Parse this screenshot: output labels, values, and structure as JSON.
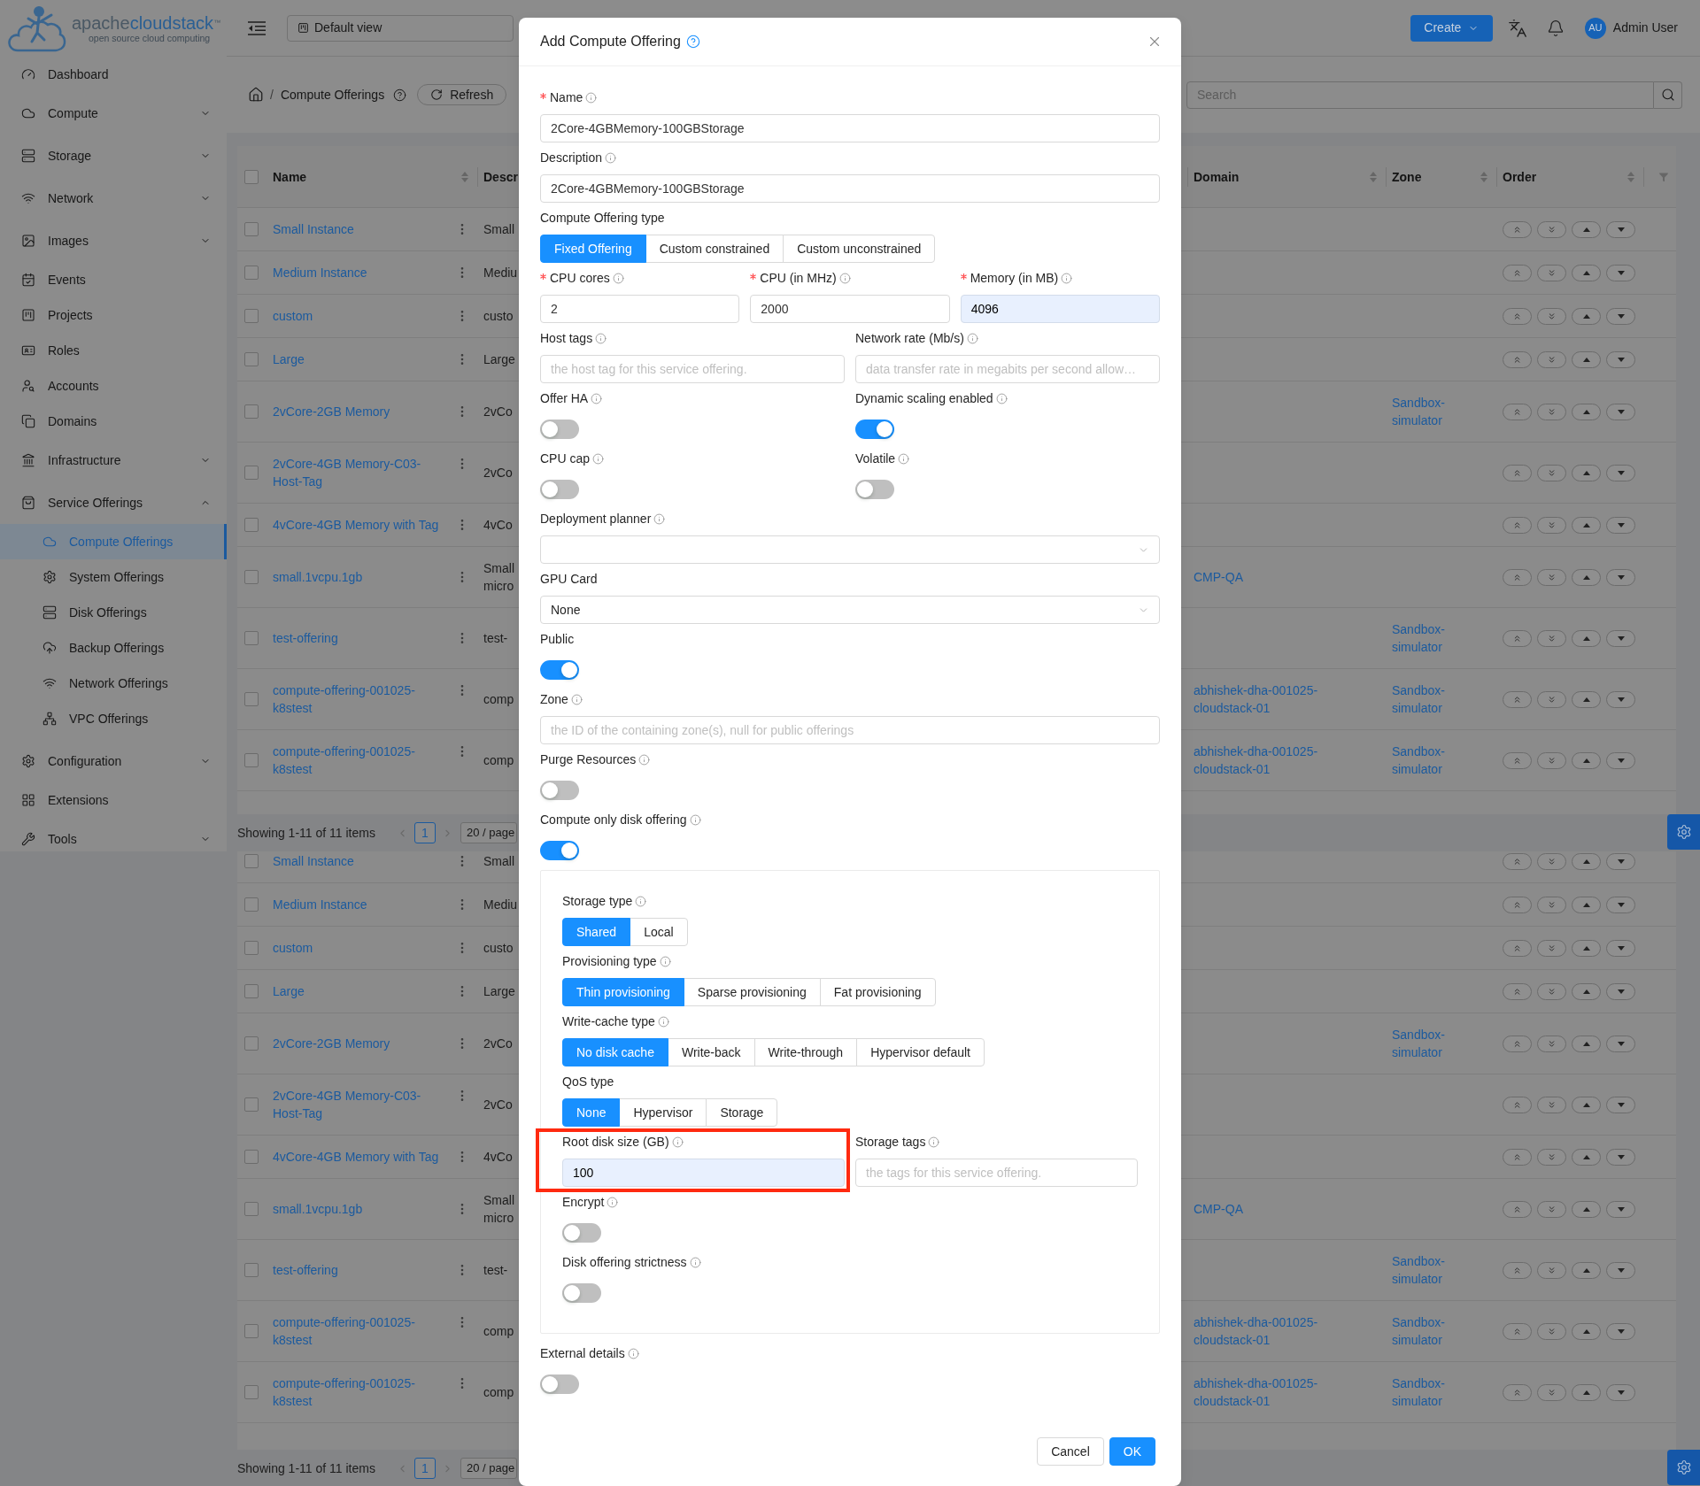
{
  "sidebar": {
    "logo": {
      "wordmark_prefix": "apache",
      "wordmark": "cloudstack",
      "trademark": "™",
      "tagline": "open source cloud computing"
    },
    "items": [
      {
        "label": "Dashboard",
        "kind": "item",
        "selected": false
      },
      {
        "label": "Compute",
        "kind": "submenu",
        "expanded": false,
        "selected": false
      },
      {
        "label": "Storage",
        "kind": "submenu",
        "expanded": false,
        "selected": false
      },
      {
        "label": "Network",
        "kind": "submenu",
        "expanded": false,
        "selected": false
      },
      {
        "label": "Images",
        "kind": "submenu",
        "expanded": false,
        "selected": false
      },
      {
        "label": "Events",
        "kind": "item",
        "selected": false
      },
      {
        "label": "Projects",
        "kind": "item",
        "selected": false
      },
      {
        "label": "Roles",
        "kind": "item",
        "selected": false
      },
      {
        "label": "Accounts",
        "kind": "item",
        "selected": false
      },
      {
        "label": "Domains",
        "kind": "item",
        "selected": false
      },
      {
        "label": "Infrastructure",
        "kind": "submenu",
        "expanded": false,
        "selected": false
      },
      {
        "label": "Service Offerings",
        "kind": "submenu",
        "expanded": true,
        "selected": false,
        "children": [
          {
            "label": "Compute Offerings",
            "selected": true
          },
          {
            "label": "System Offerings",
            "selected": false
          },
          {
            "label": "Disk Offerings",
            "selected": false
          },
          {
            "label": "Backup Offerings",
            "selected": false
          },
          {
            "label": "Network Offerings",
            "selected": false
          },
          {
            "label": "VPC Offerings",
            "selected": false
          }
        ]
      },
      {
        "label": "Configuration",
        "kind": "submenu",
        "expanded": false,
        "selected": false
      },
      {
        "label": "Extensions",
        "kind": "item",
        "selected": false
      },
      {
        "label": "Tools",
        "kind": "submenu",
        "expanded": false,
        "selected": false
      }
    ]
  },
  "header": {
    "view_select": "Default view",
    "create_button": "Create",
    "user_initials": "AU",
    "user_name": "Admin User"
  },
  "page_header": {
    "breadcrumb": {
      "separator": "/",
      "current": "Compute Offerings"
    },
    "refresh_button": "Refresh",
    "search": {
      "placeholder": "Search"
    }
  },
  "table": {
    "select_all": false,
    "columns": [
      {
        "label": "Name",
        "sortable": true
      },
      {
        "label": "Descr"
      },
      {
        "label": "Domain",
        "sortable": true
      },
      {
        "label": "Zone",
        "sortable": true
      },
      {
        "label": "Order",
        "sortable": true
      }
    ],
    "rows": [
      {
        "name": "Small Instance",
        "description": "Small",
        "checked": false
      },
      {
        "name": "Medium Instance",
        "description": "Mediu",
        "checked": false
      },
      {
        "name": "custom",
        "description": "custo",
        "checked": false
      },
      {
        "name": "Large",
        "description": "Large",
        "checked": false
      },
      {
        "name": "2vCore-2GB Memory",
        "description": "2vCo",
        "zone": "Sandbox-simulator",
        "checked": false
      },
      {
        "name": "2vCore-4GB Memory-C03-Host-Tag",
        "description": "2vCo",
        "checked": false
      },
      {
        "name": "4vCore-4GB Memory with Tag",
        "description": "4vCo",
        "checked": false
      },
      {
        "name": "small.1vcpu.1gb",
        "description": "Small micro",
        "domain": "CMP-QA",
        "checked": false
      },
      {
        "name": "test-offering",
        "description": "test-",
        "zone": "Sandbox-simulator",
        "checked": false
      },
      {
        "name": "compute-offering-001025-k8stest",
        "description": "comp",
        "domain": "abhishek-dha-001025-cloudstack-01",
        "zone": "Sandbox-simulator",
        "checked": false
      },
      {
        "name": "compute-offering-001025-k8stest",
        "description": "comp",
        "domain": "abhishek-dha-001025-cloudstack-01",
        "zone": "Sandbox-simulator",
        "checked": false
      }
    ],
    "pagination": {
      "summary": "Showing 1-11 of 11 items",
      "pages": [
        {
          "label": "1",
          "selected": true
        }
      ],
      "page_size": "20 / page"
    }
  },
  "table_repeated": {
    "rows": [
      {
        "name": "Small Instance",
        "description": "Small",
        "checked": false
      },
      {
        "name": "Medium Instance",
        "description": "Mediu",
        "checked": false
      },
      {
        "name": "custom",
        "description": "custo",
        "checked": false
      },
      {
        "name": "Large",
        "description": "Large",
        "checked": false
      },
      {
        "name": "2vCore-2GB Memory",
        "description": "2vCo",
        "zone": "Sandbox-simulator",
        "checked": false
      },
      {
        "name": "2vCore-4GB Memory-C03-Host-Tag",
        "description": "2vCo",
        "checked": false
      },
      {
        "name": "4vCore-4GB Memory with Tag",
        "description": "4vCo",
        "checked": false
      },
      {
        "name": "small.1vcpu.1gb",
        "description": "Small micro",
        "domain": "CMP-QA",
        "checked": false
      },
      {
        "name": "test-offering",
        "description": "test-",
        "zone": "Sandbox-simulator",
        "checked": false
      },
      {
        "name": "compute-offering-001025-k8stest",
        "description": "comp",
        "domain": "abhishek-dha-001025-cloudstack-01",
        "zone": "Sandbox-simulator",
        "checked": false
      },
      {
        "name": "compute-offering-001025-k8stest",
        "description": "comp",
        "domain": "abhishek-dha-001025-cloudstack-01",
        "zone": "Sandbox-simulator",
        "checked": false
      }
    ],
    "pagination": {
      "summary": "Showing 1-11 of 11 items",
      "pages": [
        {
          "label": "1",
          "selected": true
        }
      ],
      "page_size": "20 / page"
    }
  },
  "dialog": {
    "title": "Add Compute Offering",
    "help": true,
    "rows": [
      {
        "fields": [
          {
            "kind": "input",
            "label": "Name",
            "required": true,
            "info": true,
            "value": "2Core-4GBMemory-100GBStorage"
          }
        ]
      },
      {
        "fields": [
          {
            "kind": "input",
            "label": "Description",
            "info": true,
            "value": "2Core-4GBMemory-100GBStorage"
          }
        ]
      },
      {
        "fields": [
          {
            "kind": "segmented",
            "label": "Compute Offering type",
            "options": [
              {
                "label": "Fixed Offering",
                "selected": true
              },
              {
                "label": "Custom constrained",
                "selected": false
              },
              {
                "label": "Custom unconstrained",
                "selected": false
              }
            ]
          }
        ]
      },
      {
        "fields": [
          {
            "kind": "input",
            "label": "CPU cores",
            "required": true,
            "info": true,
            "value": "2"
          },
          {
            "kind": "input",
            "label": "CPU (in MHz)",
            "required": true,
            "info": true,
            "value": "2000"
          },
          {
            "kind": "input",
            "label": "Memory (in MB)",
            "required": true,
            "info": true,
            "value": "4096",
            "autofilled": true
          }
        ]
      },
      {
        "fields": [
          {
            "kind": "input",
            "label": "Host tags",
            "info": true,
            "placeholder": "the host tag for this service offering."
          },
          {
            "kind": "input",
            "label": "Network rate (Mb/s)",
            "info": true,
            "placeholder": "data transfer rate in megabits per second allow…"
          }
        ]
      },
      {
        "fields": [
          {
            "kind": "switch",
            "label": "Offer HA",
            "info": true,
            "on": false
          },
          {
            "kind": "switch",
            "label": "Dynamic scaling enabled",
            "info": true,
            "on": true
          }
        ]
      },
      {
        "fields": [
          {
            "kind": "switch",
            "label": "CPU cap",
            "info": true,
            "on": false
          },
          {
            "kind": "switch",
            "label": "Volatile",
            "info": true,
            "on": false
          }
        ]
      },
      {
        "fields": [
          {
            "kind": "select",
            "label": "Deployment planner",
            "info": true
          }
        ]
      },
      {
        "fields": [
          {
            "kind": "select",
            "label": "GPU Card",
            "value": "None"
          }
        ]
      },
      {
        "fields": [
          {
            "kind": "switch",
            "label": "Public",
            "on": true
          }
        ]
      },
      {
        "fields": [
          {
            "kind": "input",
            "label": "Zone",
            "info": true,
            "placeholder": "the ID of the containing zone(s), null for public offerings"
          }
        ]
      },
      {
        "fields": [
          {
            "kind": "switch",
            "label": "Purge Resources",
            "info": true,
            "on": false
          }
        ]
      },
      {
        "fields": [
          {
            "kind": "switch",
            "label": "Compute only disk offering",
            "info": true,
            "on": true
          }
        ]
      },
      {
        "fields": [
          {
            "kind": "group",
            "rows": [
              {
                "fields": [
                  {
                    "kind": "segmented",
                    "label": "Storage type",
                    "info": true,
                    "options": [
                      {
                        "label": "Shared",
                        "selected": true
                      },
                      {
                        "label": "Local",
                        "selected": false
                      }
                    ]
                  }
                ]
              },
              {
                "fields": [
                  {
                    "kind": "segmented",
                    "label": "Provisioning type",
                    "info": true,
                    "options": [
                      {
                        "label": "Thin provisioning",
                        "selected": true
                      },
                      {
                        "label": "Sparse provisioning",
                        "selected": false
                      },
                      {
                        "label": "Fat provisioning",
                        "selected": false
                      }
                    ]
                  }
                ]
              },
              {
                "fields": [
                  {
                    "kind": "segmented",
                    "label": "Write-cache type",
                    "info": true,
                    "options": [
                      {
                        "label": "No disk cache",
                        "selected": true
                      },
                      {
                        "label": "Write-back",
                        "selected": false
                      },
                      {
                        "label": "Write-through",
                        "selected": false
                      },
                      {
                        "label": "Hypervisor default",
                        "selected": false
                      }
                    ]
                  }
                ]
              },
              {
                "fields": [
                  {
                    "kind": "segmented",
                    "label": "QoS type",
                    "options": [
                      {
                        "label": "None",
                        "selected": true
                      },
                      {
                        "label": "Hypervisor",
                        "selected": false
                      },
                      {
                        "label": "Storage",
                        "selected": false
                      }
                    ]
                  }
                ]
              },
              {
                "fields": [
                  {
                    "kind": "input",
                    "label": "Root disk size (GB)",
                    "info": true,
                    "value": "100",
                    "autofilled": true,
                    "highlighted": true
                  },
                  {
                    "kind": "input",
                    "label": "Storage tags",
                    "info": true,
                    "placeholder": "the tags for this service offering."
                  }
                ]
              },
              {
                "fields": [
                  {
                    "kind": "switch",
                    "label": "Encrypt",
                    "info": true,
                    "on": false
                  }
                ]
              },
              {
                "fields": [
                  {
                    "kind": "switch",
                    "label": "Disk offering strictness",
                    "info": true,
                    "on": false
                  }
                ]
              }
            ]
          }
        ]
      },
      {
        "fields": [
          {
            "kind": "switch",
            "label": "External details",
            "info": true,
            "on": false
          }
        ]
      }
    ],
    "buttons": [
      {
        "label": "Cancel",
        "kind": "default"
      },
      {
        "label": "OK",
        "kind": "primary"
      }
    ]
  }
}
